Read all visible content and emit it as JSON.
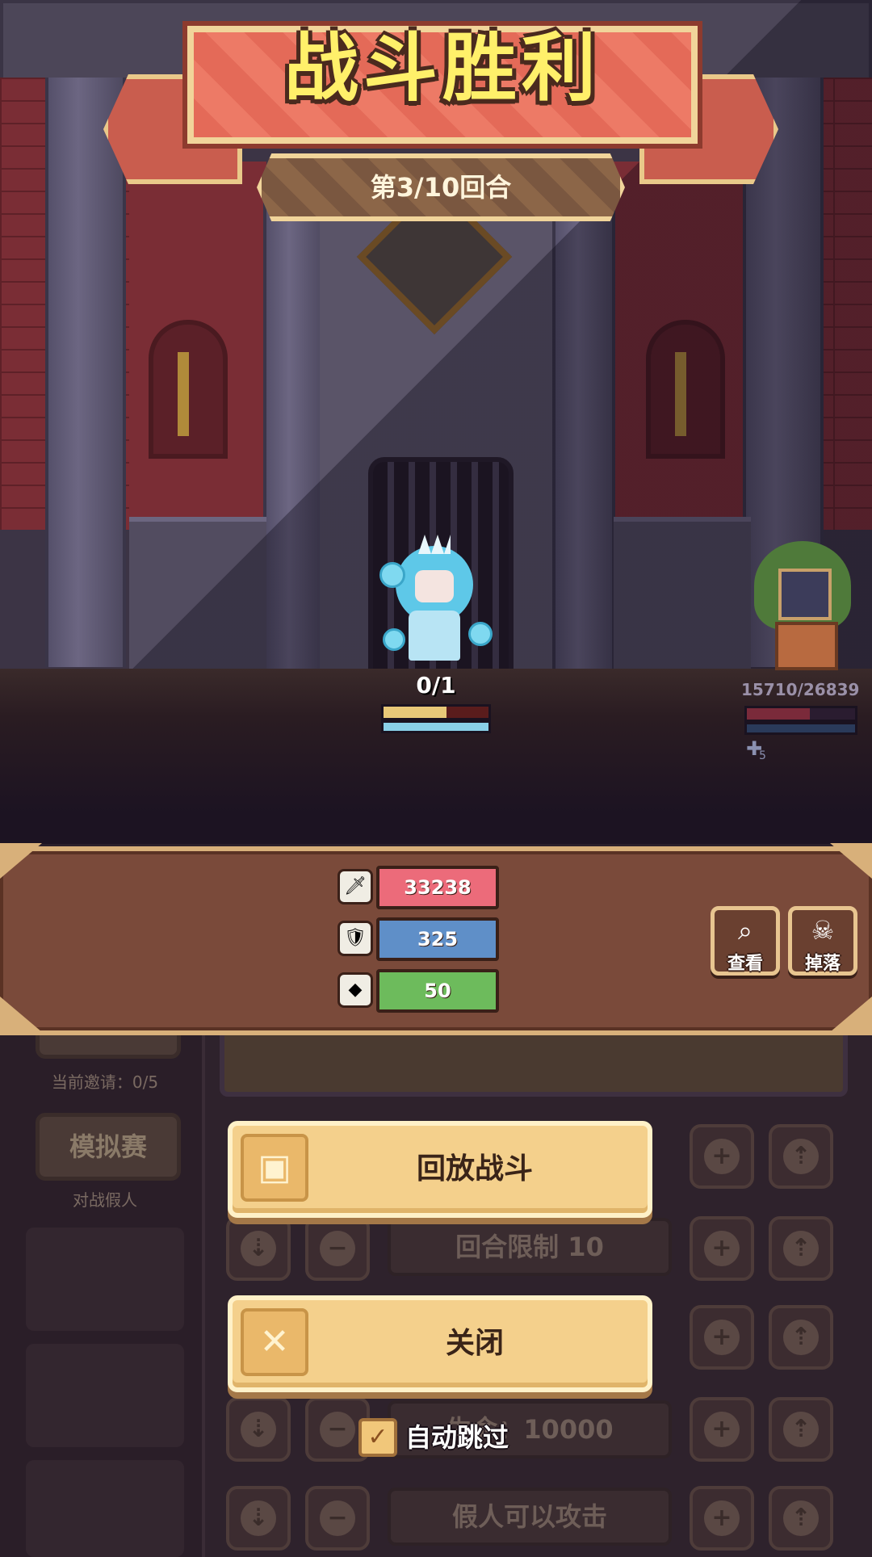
{
  "banner": {
    "title": "战斗胜利",
    "round": "第3/10回合"
  },
  "battle": {
    "hero_counter": "0/1",
    "hero_hp_fraction": 0.6,
    "enemy_hp_text": "15710/26839",
    "enemy_hp_fraction": 0.585,
    "enemy_buff_count": "5"
  },
  "stats": {
    "attack": "33238",
    "defense": "325",
    "speed": "50",
    "colors": {
      "attack": "#ec6b7a",
      "defense": "#5f8fc8",
      "speed": "#6dbb5c"
    }
  },
  "actions": {
    "view_label": "查看",
    "drops_label": "掉落"
  },
  "background_ui": {
    "invite_count": "当前邀请：0/5",
    "sim_match_label": "模拟赛",
    "vs_dummy": "对战假人",
    "round_limit": "回合限制 10",
    "hp_field": "生命：10000",
    "dummy_can_attack": "假人可以攻击"
  },
  "dialog": {
    "replay_label": "回放战斗",
    "close_label": "关闭",
    "auto_skip_label": "自动跳过",
    "auto_skip_checked": true
  }
}
